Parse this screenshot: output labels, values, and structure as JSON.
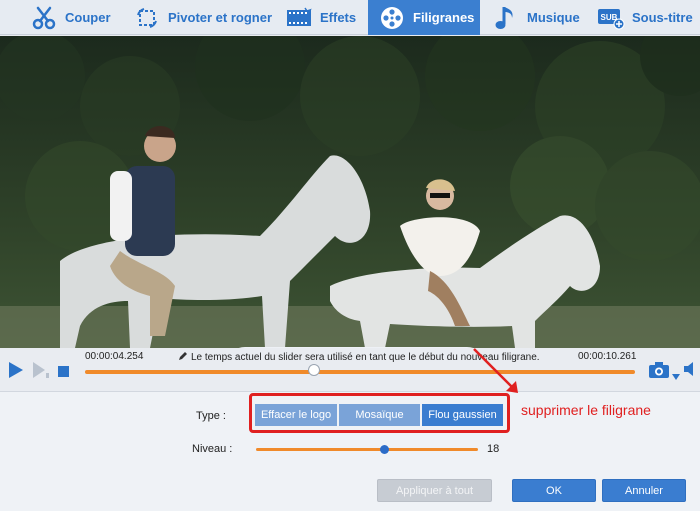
{
  "tabs": [
    {
      "label": "Couper",
      "icon": "scissors-icon",
      "active": false
    },
    {
      "label": "Pivoter et rogner",
      "icon": "rotate-crop-icon",
      "active": false
    },
    {
      "label": "Effets",
      "icon": "film-effects-icon",
      "active": false
    },
    {
      "label": "Filigranes",
      "icon": "watermark-reel-icon",
      "active": true
    },
    {
      "label": "Musique",
      "icon": "music-note-icon",
      "active": false
    },
    {
      "label": "Sous-titre",
      "icon": "subtitle-icon",
      "active": false
    }
  ],
  "watermark_tools": [
    {
      "icon": "add-text-watermark-icon"
    },
    {
      "icon": "add-image-watermark-icon"
    },
    {
      "icon": "add-video-watermark-icon"
    },
    {
      "icon": "add-scissors-watermark-icon"
    },
    {
      "icon": "add-eraser-watermark-icon"
    }
  ],
  "timeline": {
    "start_time": "00:00:04.254",
    "end_time": "00:00:10.261",
    "hint": "Le temps actuel du slider sera utilisé en tant que le début du nouveau filigrane."
  },
  "settings": {
    "type_label": "Type :",
    "type_options": [
      "Effacer le logo",
      "Mosaïque",
      "Flou gaussien"
    ],
    "selected_type": "Flou gaussien",
    "level_label": "Niveau :",
    "level_value": "18",
    "annotation": "supprimer le filigrane"
  },
  "buttons": {
    "apply_all": "Appliquer à tout",
    "ok": "OK",
    "cancel": "Annuler"
  },
  "colors": {
    "accent": "#3b7fd0",
    "slider": "#f08a2a",
    "annotation": "#e02020"
  }
}
